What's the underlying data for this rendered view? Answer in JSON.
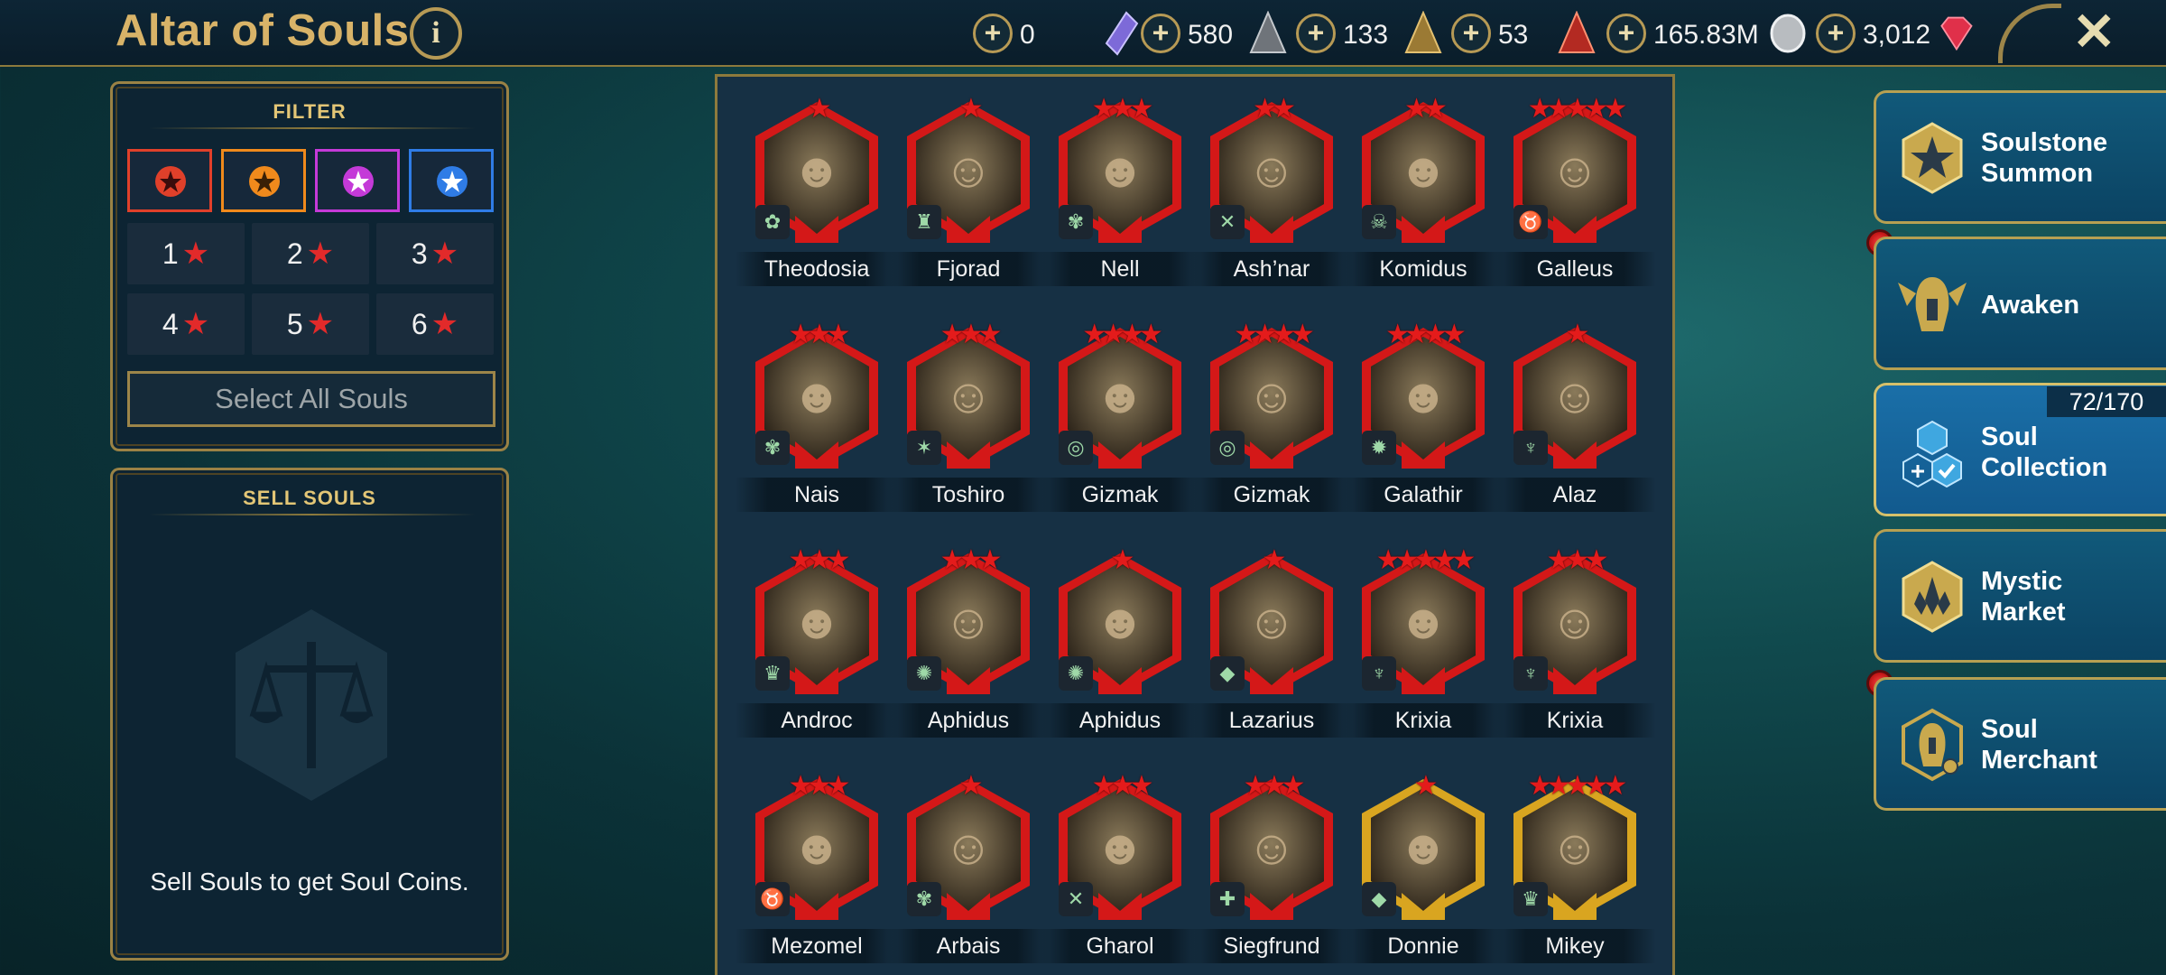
{
  "header": {
    "title": "Altar of Souls",
    "info_label": "i",
    "close_label": "✕",
    "currencies": [
      {
        "name": "mystery-shard",
        "value": "0",
        "color": "#7d6ad8"
      },
      {
        "name": "ancient-shard",
        "value": "580",
        "color": "#8a8f94"
      },
      {
        "name": "void-shard",
        "value": "133",
        "color": "#b08c3c"
      },
      {
        "name": "sacred-shard",
        "value": "53",
        "color": "#c23a2a"
      },
      {
        "name": "silver",
        "value": "165.83M",
        "color": "#c9ccd0"
      },
      {
        "name": "gems",
        "value": "3,012",
        "color": "#e0304a"
      }
    ],
    "plus_label": "+"
  },
  "filter": {
    "title": "FILTER",
    "rarities": [
      {
        "name": "rare",
        "color": "#e0402a"
      },
      {
        "name": "epic",
        "color": "#f08a1c"
      },
      {
        "name": "legendary",
        "color": "#c43ad8"
      },
      {
        "name": "mythical",
        "color": "#2f7ce6"
      }
    ],
    "star_buttons": [
      "1",
      "2",
      "3",
      "4",
      "5",
      "6"
    ],
    "star_glyph": "★",
    "select_all": "Select All Souls"
  },
  "sell": {
    "title": "SELL SOULS",
    "message": "Sell Souls to get Soul Coins."
  },
  "heroes": [
    {
      "name": "Theodosia",
      "stars": "★",
      "faction": "✿",
      "frame": "red"
    },
    {
      "name": "Fjorad",
      "stars": "★",
      "faction": "♜",
      "frame": "red"
    },
    {
      "name": "Nell",
      "stars": "★★★",
      "faction": "✾",
      "frame": "red"
    },
    {
      "name": "Ash’nar",
      "stars": "★★",
      "faction": "✕",
      "frame": "red"
    },
    {
      "name": "Komidus",
      "stars": "★★",
      "faction": "☠",
      "frame": "red"
    },
    {
      "name": "Galleus",
      "stars": "★★★★★",
      "faction": "♉",
      "frame": "red"
    },
    {
      "name": "Nais",
      "stars": "★★★",
      "faction": "✾",
      "frame": "red"
    },
    {
      "name": "Toshiro",
      "stars": "★★★",
      "faction": "✶",
      "frame": "red"
    },
    {
      "name": "Gizmak",
      "stars": "★★★★",
      "faction": "◎",
      "frame": "red"
    },
    {
      "name": "Gizmak",
      "stars": "★★★★",
      "faction": "◎",
      "frame": "red"
    },
    {
      "name": "Galathir",
      "stars": "★★★★",
      "faction": "✹",
      "frame": "red"
    },
    {
      "name": "Alaz",
      "stars": "★",
      "faction": "♆",
      "frame": "red"
    },
    {
      "name": "Androc",
      "stars": "★★★",
      "faction": "♛",
      "frame": "red"
    },
    {
      "name": "Aphidus",
      "stars": "★★★",
      "faction": "✺",
      "frame": "red"
    },
    {
      "name": "Aphidus",
      "stars": "★",
      "faction": "✺",
      "frame": "red"
    },
    {
      "name": "Lazarius",
      "stars": "★",
      "faction": "◆",
      "frame": "red"
    },
    {
      "name": "Krixia",
      "stars": "★★★★★",
      "faction": "♆",
      "frame": "red"
    },
    {
      "name": "Krixia",
      "stars": "★★★",
      "faction": "♆",
      "frame": "red"
    },
    {
      "name": "Mezomel",
      "stars": "★★★",
      "faction": "♉",
      "frame": "red"
    },
    {
      "name": "Arbais",
      "stars": "★",
      "faction": "✾",
      "frame": "red"
    },
    {
      "name": "Gharol",
      "stars": "★★★",
      "faction": "✕",
      "frame": "red"
    },
    {
      "name": "Siegfrund",
      "stars": "★★★",
      "faction": "✚",
      "frame": "red"
    },
    {
      "name": "Donnie",
      "stars": "★",
      "faction": "◆",
      "frame": "gold"
    },
    {
      "name": "Mikey",
      "stars": "★★★★★",
      "faction": "♛",
      "frame": "gold"
    }
  ],
  "menu": {
    "items": [
      {
        "label1": "Soulstone",
        "label2": "Summon",
        "icon": "star-icon"
      },
      {
        "label1": "Awaken",
        "label2": "",
        "icon": "winged-helmet-icon"
      },
      {
        "label1": "Soul",
        "label2": "Collection",
        "icon": "hexagon-check-icon"
      },
      {
        "label1": "Mystic",
        "label2": "Market",
        "icon": "crystal-icon"
      },
      {
        "label1": "Soul",
        "label2": "Merchant",
        "icon": "merchant-helmet-icon"
      }
    ],
    "collection_count": "72/170"
  },
  "colors": {
    "gold": "#d8b368",
    "frame_red": "#d41818",
    "frame_gold": "#d9a520",
    "panel": "#0d2433"
  }
}
